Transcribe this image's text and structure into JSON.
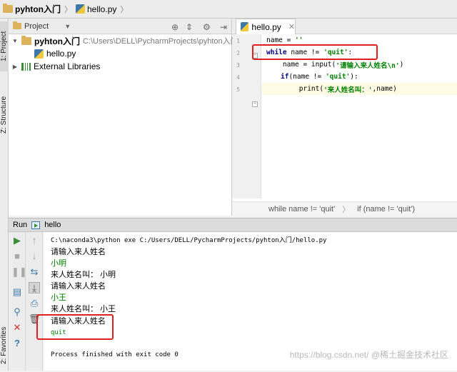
{
  "navbar": {
    "project_name": "pyhton入门",
    "file_name": "hello.py"
  },
  "left_strip": {
    "project_tab": "1: Project",
    "structure_tab": "Z: Structure",
    "favorites_tab": "2: Favorites"
  },
  "project_panel": {
    "view_label": "Project",
    "root_name": "pyhton入门",
    "root_path": "C:\\Users\\DELL\\PycharmProjects\\pyhton入门",
    "file": "hello.py",
    "external_libraries": "External Libraries"
  },
  "editor": {
    "tab_label": "hello.py",
    "line_numbers": [
      "1",
      "2",
      "3",
      "4",
      "5"
    ],
    "lines": {
      "l1_var": "name = ",
      "l1_str": "''",
      "l2_kw": "while",
      "l2_rest": " name != ",
      "l2_str": "'quit'",
      "l2_end": ":",
      "l3_pre": "    name = input(",
      "l3_str": "'请输入来人姓名\\n'",
      "l3_end": ")",
      "l4_kw": "if",
      "l4_rest": "(name != ",
      "l4_str": "'quit'",
      "l4_end": "):",
      "l5_pre": "        print(",
      "l5_str": "'来人姓名叫：'",
      "l5_end": ",name)"
    },
    "breadcrumb": {
      "item1": "while name != 'quit'",
      "item2": "if (name != 'quit')"
    }
  },
  "run_panel": {
    "label": "Run",
    "config_name": "hello"
  },
  "console": {
    "command": "C:\\naconda3\\python exe C:/Users/DELL/PycharmProjects/pyhton入门/hello.py",
    "lines": [
      {
        "text": "请输入来人姓名",
        "kind": "output"
      },
      {
        "text": "小明",
        "kind": "input"
      },
      {
        "text": "来人姓名叫： 小明",
        "kind": "output"
      },
      {
        "text": "请输入来人姓名",
        "kind": "output"
      },
      {
        "text": "小王",
        "kind": "input"
      },
      {
        "text": "来人姓名叫： 小王",
        "kind": "output"
      },
      {
        "text": "请输入来人姓名",
        "kind": "output"
      },
      {
        "text": "quit",
        "kind": "input"
      }
    ],
    "exit_message": "Process finished with exit code 0"
  },
  "watermark": "https://blog.csdn.net/ @稀土掘金技术社区",
  "colors": {
    "keyword": "#000080",
    "string": "#008000",
    "highlight_box": "#e02020",
    "console_input": "#008000"
  }
}
